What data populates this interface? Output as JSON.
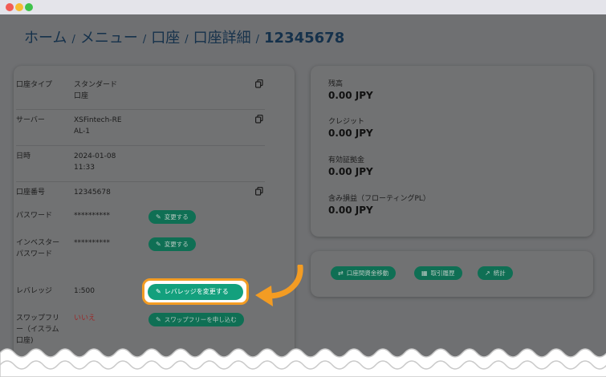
{
  "window": {
    "controls": [
      "close",
      "minimize",
      "zoom"
    ]
  },
  "breadcrumb": {
    "items": [
      "ホーム",
      "メニュー",
      "口座",
      "口座詳細"
    ],
    "current": "12345678",
    "separator": "/"
  },
  "account": {
    "rows": [
      {
        "label": "口座タイプ",
        "value": "スタンダード口座",
        "copy": true
      },
      {
        "label": "サーバー",
        "value": "XSFintech-REAL-1",
        "copy": true
      },
      {
        "label": "日時",
        "value": "2024-01-08 11:33"
      },
      {
        "label": "口座番号",
        "value": "12345678",
        "copy": true
      },
      {
        "label": "パスワード",
        "value": "**********",
        "button": "変更する"
      },
      {
        "label": "インベスターパスワード",
        "value": "**********",
        "button": "変更する"
      },
      {
        "label": "レバレッジ",
        "value": "1:500",
        "button": "レバレッジを変更する"
      },
      {
        "label": "スワップフリー（イスラム口座)",
        "value": "いいえ",
        "button": "スワップフリーを申し込む"
      }
    ]
  },
  "balances": [
    {
      "label": "残高",
      "value": "0.00 JPY"
    },
    {
      "label": "クレジット",
      "value": "0.00 JPY"
    },
    {
      "label": "有効証拠金",
      "value": "0.00 JPY"
    },
    {
      "label": "含み損益（フローティングPL）",
      "value": "0.00 JPY"
    }
  ],
  "actions": [
    {
      "label": "口座間資金移動",
      "icon": "transfer-icon"
    },
    {
      "label": "取引履歴",
      "icon": "table-icon"
    },
    {
      "label": "統計",
      "icon": "chart-icon"
    }
  ],
  "colors": {
    "overlay": "#6f7072",
    "button": "#0f6f54",
    "highlight_button": "#13a07d",
    "highlight_border": "#f39c23",
    "no_value": "#9a2a2a"
  }
}
